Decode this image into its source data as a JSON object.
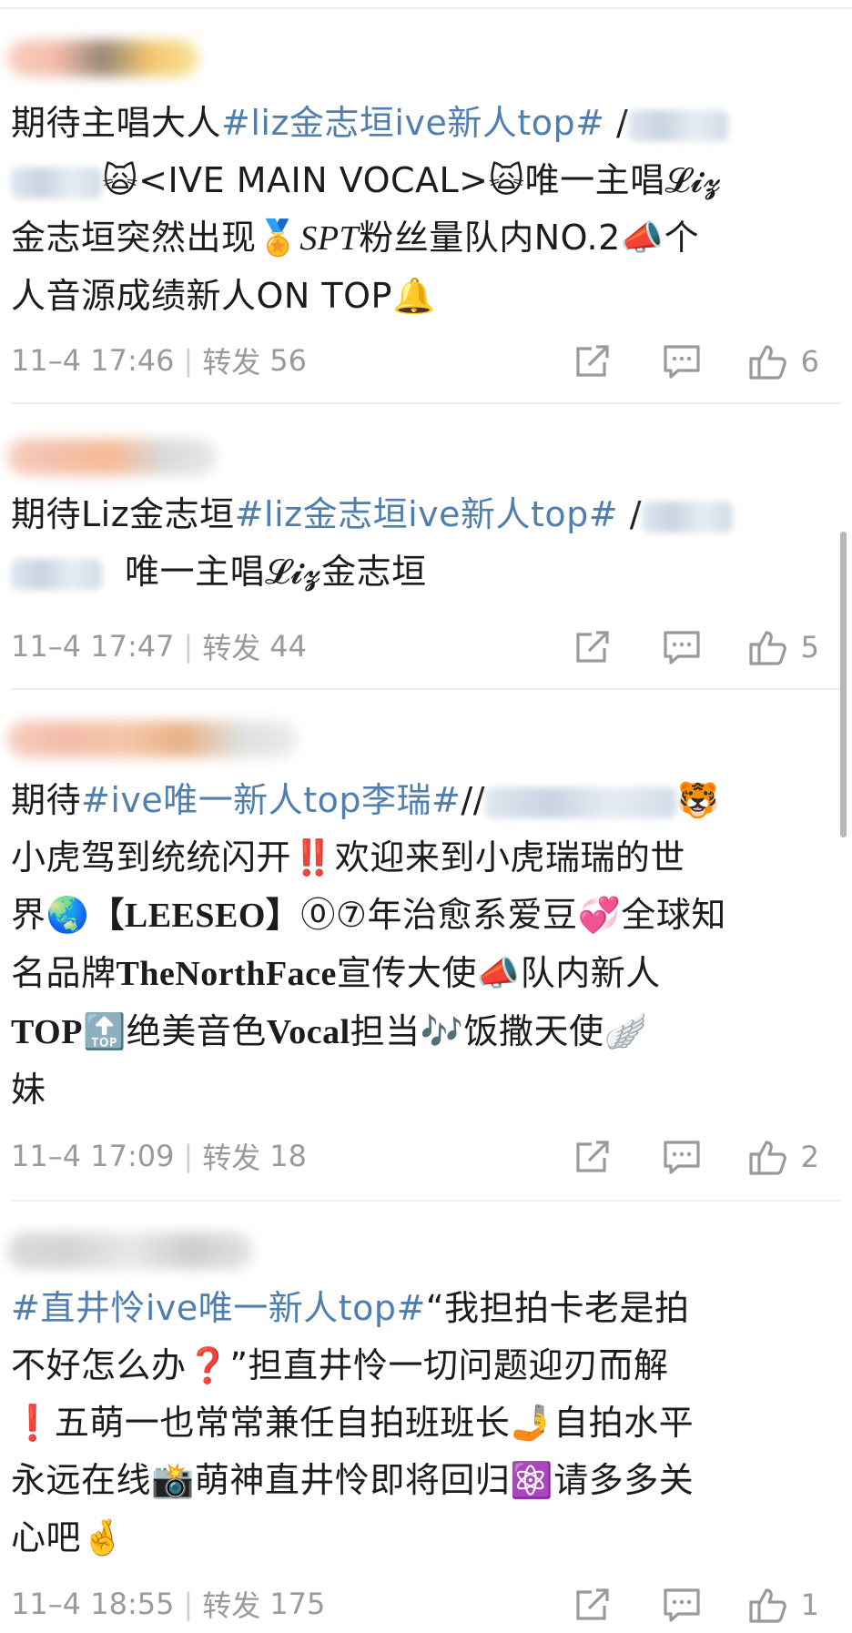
{
  "posts": [
    {
      "line1": {
        "pre": "期待主唱大人",
        "tag": "#liz金志垣ive新人top#",
        "post": " /"
      },
      "line2": {
        "emoji1": "🙀",
        "text": "<IVE MAIN VOCAL>",
        "emoji2": "🙀",
        "text2": "唯一主唱",
        "script": "𝓛𝓲𝔃"
      },
      "line3": {
        "text": "金志垣突然出现",
        "medal": "🏅",
        "spt": "SPT",
        "text2": "粉丝量队内NO.2",
        "mega": "📣",
        "text3": "个"
      },
      "line4": {
        "text": "人音源成绩新人ON TOP",
        "bell": "🔔"
      },
      "time": "11–4 17:46",
      "repost_label": "转发",
      "repost": "56",
      "likes": "6"
    },
    {
      "line1": {
        "pre": "期待Liz金志垣",
        "tag": "#liz金志垣ive新人top#",
        "post": " /"
      },
      "line2": {
        "text": "唯一主唱",
        "script": "𝓛𝓲𝔃",
        "text2": "金志垣"
      },
      "time": "11–4 17:47",
      "repost_label": "转发",
      "repost": "44",
      "likes": "5"
    },
    {
      "line1": {
        "pre": "期待",
        "tag": "#ive唯一新人top李瑞#",
        "post": "//",
        "emoji": "🐯"
      },
      "line2": {
        "text": "小虎驾到统统闪开",
        "bang": "‼️",
        "text2": "欢迎来到小虎瑞瑞的世"
      },
      "line3": {
        "text": "界",
        "globe": "🌏",
        "bold": "【LEESEO】",
        "circ": "⓪⑦",
        "text2": "年治愈系爱豆",
        "heart": "💞",
        "text3": "全球知"
      },
      "line4": {
        "text": "名品牌",
        "bold": "TheNorthFace",
        "text2": "宣传大使",
        "mega": "📣",
        "text3": "队内新人"
      },
      "line5": {
        "bold": "TOP",
        "top": "🔝",
        "text": "绝美音色",
        "bold2": "Vocal",
        "text2": "担当",
        "notes": "🎶",
        "text3": "饭撒天使",
        "wing": "🪽"
      },
      "line6": {
        "text": "妹"
      },
      "time": "11–4 17:09",
      "repost_label": "转发",
      "repost": "18",
      "likes": "2"
    },
    {
      "line1": {
        "tag": "#直井怜ive唯一新人top#",
        "text": "“我担拍卡老是拍"
      },
      "line2": {
        "text": "不好怎么办",
        "q": "❓",
        "text2": "”担直井怜一切问题迎刃而解"
      },
      "line3": {
        "bang": "❗",
        "text": "五萌一也常常兼任自拍班班长",
        "selfie": "🤳",
        "text2": "自拍水平"
      },
      "line4": {
        "text": "永远在线",
        "cam": "📸",
        "text2": "萌神直井怜即将回归",
        "atom": "⚛️",
        "text3": "请多多关"
      },
      "line5": {
        "text": "心吧",
        "fingers": "🤞"
      },
      "time": "11–4 18:55",
      "repost_label": "转发",
      "repost": "175",
      "likes": "1"
    }
  ],
  "icons": {
    "share": "share-icon",
    "comment": "comment-icon",
    "like": "thumbs-up-icon"
  },
  "colors": {
    "topic": "#4f7fb0",
    "meta": "#9a9a9a",
    "text": "#1c1c1c"
  }
}
